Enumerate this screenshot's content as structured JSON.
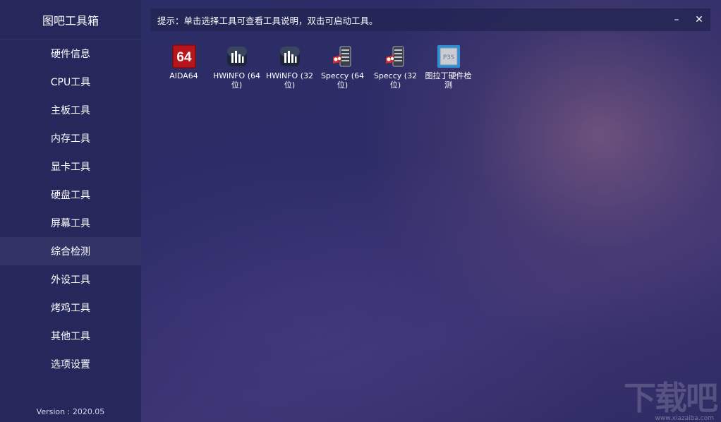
{
  "app": {
    "title": "图吧工具箱",
    "version": "Version : 2020.05"
  },
  "sidebar": {
    "items": [
      {
        "label": "硬件信息"
      },
      {
        "label": "CPU工具"
      },
      {
        "label": "主板工具"
      },
      {
        "label": "内存工具"
      },
      {
        "label": "显卡工具"
      },
      {
        "label": "硬盘工具"
      },
      {
        "label": "屏幕工具"
      },
      {
        "label": "综合检测",
        "active": true
      },
      {
        "label": "外设工具"
      },
      {
        "label": "烤鸡工具"
      },
      {
        "label": "其他工具"
      },
      {
        "label": "选项设置"
      }
    ]
  },
  "header": {
    "hint": "提示：单击选择工具可查看工具说明，双击可启动工具。",
    "minimize_label": "–",
    "close_label": "✕"
  },
  "tools": [
    {
      "label": "AIDA64",
      "icon": "aida64-icon"
    },
    {
      "label": "HWiNFO (64位)",
      "icon": "hwinfo-icon"
    },
    {
      "label": "HWiNFO (32位)",
      "icon": "hwinfo-icon"
    },
    {
      "label": "Speccy (64位)",
      "icon": "speccy-icon"
    },
    {
      "label": "Speccy (32位)",
      "icon": "speccy-icon"
    },
    {
      "label": "图拉丁硬件检测",
      "icon": "tulading-icon"
    }
  ],
  "watermark": {
    "text": "下载吧",
    "url": "www.xiazaiba.com"
  },
  "colors": {
    "sidebar_bg": "#26285c",
    "main_bg": "#2b2d66",
    "text": "#ffffff",
    "aida_red": "#b8141c"
  }
}
